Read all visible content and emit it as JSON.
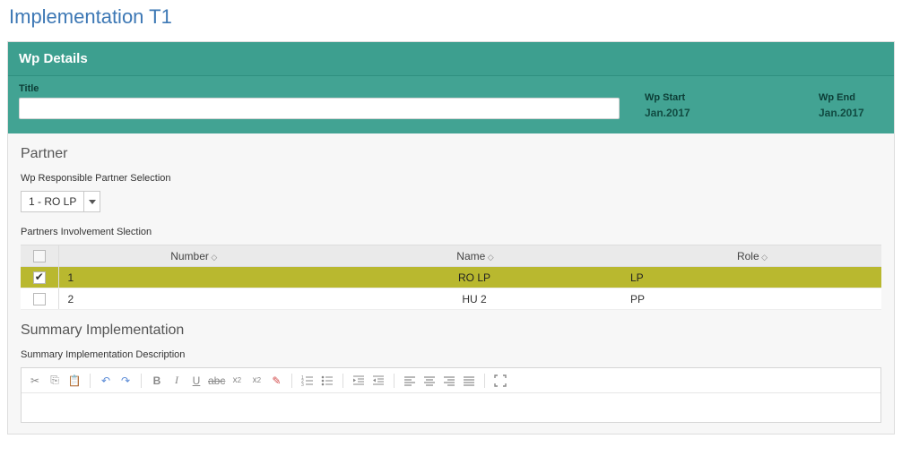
{
  "page": {
    "title": "Implementation T1"
  },
  "wp_details": {
    "panel_title": "Wp Details",
    "title_label": "Title",
    "title_value": "",
    "start_label": "Wp Start",
    "start_value": "Jan.2017",
    "end_label": "Wp End",
    "end_value": "Jan.2017"
  },
  "partner": {
    "section_title": "Partner",
    "responsible_label": "Wp Responsible Partner Selection",
    "dropdown_selected": "1 - RO LP",
    "involvement_label": "Partners Involvement Slection",
    "columns": {
      "number": "Number",
      "name": "Name",
      "role": "Role"
    },
    "rows": [
      {
        "checked": true,
        "number": "1",
        "name": "RO LP",
        "role": "LP"
      },
      {
        "checked": false,
        "number": "2",
        "name": "HU 2",
        "role": "PP"
      }
    ]
  },
  "summary": {
    "section_title": "Summary Implementation",
    "description_label": "Summary Implementation Description"
  }
}
